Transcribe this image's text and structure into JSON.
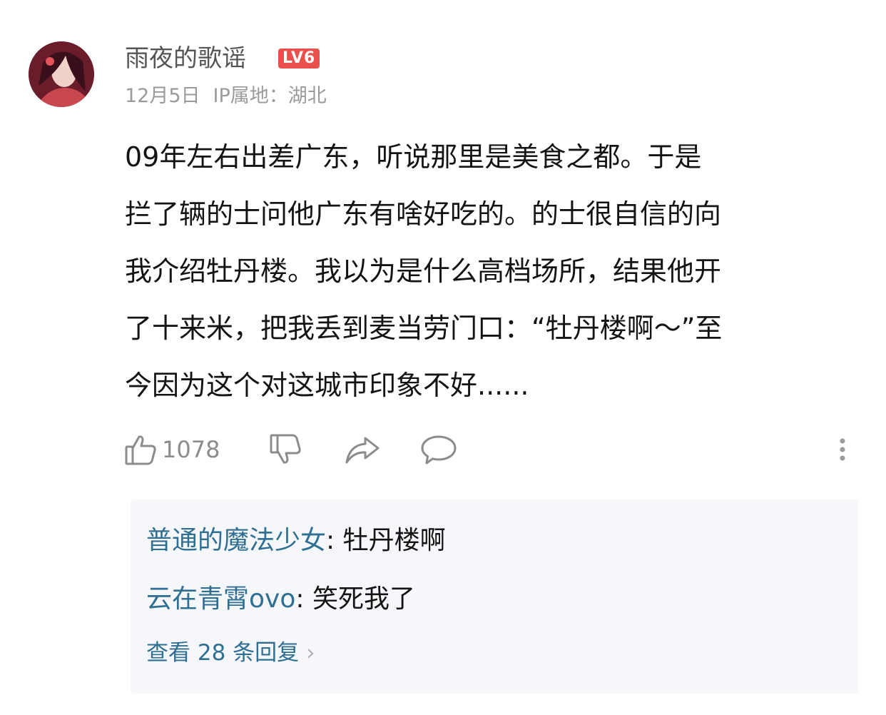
{
  "post": {
    "username": "雨夜的歌谣",
    "level_badge": "LV6",
    "date": "12月5日",
    "ip_location": "IP属地：湖北",
    "content_lines": [
      "09年左右出差广东，听说那里是美食之都。于是",
      "拦了辆的士问他广东有啥好吃的。的士很自信的向",
      "我介绍牡丹楼。我以为是什么高档场所，结果他开",
      "了十来米，把我丢到麦当劳门口：“牡丹楼啊～”至",
      "今因为这个对这城市印象不好......"
    ],
    "like_count": "1078"
  },
  "icons": {
    "like": "thumbs-up-icon",
    "dislike": "thumbs-down-icon",
    "share": "share-icon",
    "comment": "comment-icon",
    "more": "more-vertical-icon"
  },
  "replies": {
    "items": [
      {
        "name": "普通的魔法少女",
        "separator": ": ",
        "text": "牡丹楼啊"
      },
      {
        "name": "云在青霄ovo",
        "separator": ": ",
        "text": "笑死我了"
      }
    ],
    "view_all": "查看 28 条回复",
    "view_all_chevron": "›"
  },
  "colors": {
    "badge": "#e9504b",
    "reply_name": "#2f6f92",
    "meta": "#9a9a9a",
    "reply_bg": "#f6f7fb"
  }
}
